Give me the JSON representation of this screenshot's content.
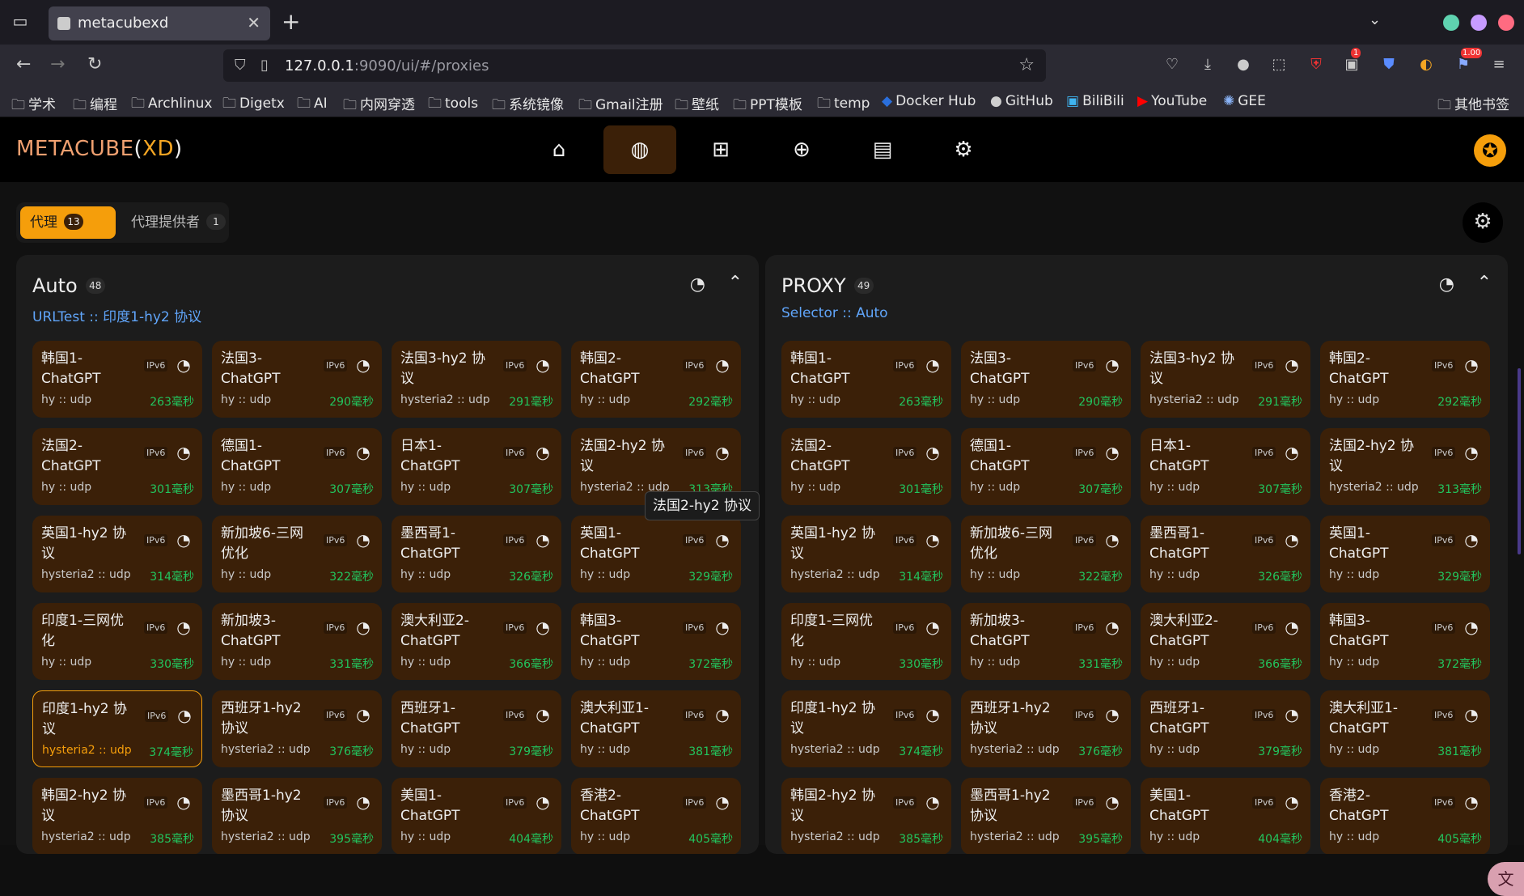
{
  "browser": {
    "tab_title": "metacubexd",
    "url_host": "127.0.0.1",
    "url_rest": ":9090/ui/#/proxies",
    "bookmarks": [
      "学术",
      "编程",
      "Archlinux",
      "Digetx",
      "AI",
      "内网穿透",
      "tools",
      "系统镜像",
      "Gmail注册",
      "壁纸",
      "PPT模板",
      "temp",
      "Docker Hub",
      "GitHub",
      "BiliBili",
      "YouTube",
      "GEE"
    ],
    "other_bookmarks": "其他书签",
    "ext_badges": {
      "ublock": "1",
      "rss": "1.00"
    }
  },
  "app": {
    "logo_main": "METACUBE",
    "logo_open": "(",
    "logo_xd": "XD",
    "logo_close": ")",
    "accent": "#f59e0b",
    "card_bg": "#3b2008",
    "latency_color": "#22c55e"
  },
  "tabs": {
    "proxies_label": "代理",
    "proxies_count": "13",
    "providers_label": "代理提供者",
    "providers_count": "1"
  },
  "tooltip": "法国2-hy2 协议",
  "groups": [
    {
      "name": "Auto",
      "count": "48",
      "subtitle": "URLTest :: 印度1-hy2 协议",
      "proxies": [
        {
          "name": "韩国1-ChatGPT",
          "type": "hy :: udp",
          "ipv6": "IPv6",
          "latency": "263毫秒"
        },
        {
          "name": "法国3-ChatGPT",
          "type": "hy :: udp",
          "ipv6": "IPv6",
          "latency": "290毫秒"
        },
        {
          "name": "法国3-hy2 协议",
          "type": "hysteria2 :: udp",
          "ipv6": "IPv6",
          "latency": "291毫秒"
        },
        {
          "name": "韩国2-ChatGPT",
          "type": "hy :: udp",
          "ipv6": "IPv6",
          "latency": "292毫秒"
        },
        {
          "name": "法国2-ChatGPT",
          "type": "hy :: udp",
          "ipv6": "IPv6",
          "latency": "301毫秒"
        },
        {
          "name": "德国1-ChatGPT",
          "type": "hy :: udp",
          "ipv6": "IPv6",
          "latency": "307毫秒"
        },
        {
          "name": "日本1-ChatGPT",
          "type": "hy :: udp",
          "ipv6": "IPv6",
          "latency": "307毫秒"
        },
        {
          "name": "法国2-hy2 协议",
          "type": "hysteria2 :: udp",
          "ipv6": "IPv6",
          "latency": "313毫秒"
        },
        {
          "name": "英国1-hy2 协议",
          "type": "hysteria2 :: udp",
          "ipv6": "IPv6",
          "latency": "314毫秒"
        },
        {
          "name": "新加坡6-三网优化",
          "type": "hy :: udp",
          "ipv6": "IPv6",
          "latency": "322毫秒"
        },
        {
          "name": "墨西哥1-ChatGPT",
          "type": "hy :: udp",
          "ipv6": "IPv6",
          "latency": "326毫秒"
        },
        {
          "name": "英国1-ChatGPT",
          "type": "hy :: udp",
          "ipv6": "IPv6",
          "latency": "329毫秒"
        },
        {
          "name": "印度1-三网优化",
          "type": "hy :: udp",
          "ipv6": "IPv6",
          "latency": "330毫秒"
        },
        {
          "name": "新加坡3-ChatGPT",
          "type": "hy :: udp",
          "ipv6": "IPv6",
          "latency": "331毫秒"
        },
        {
          "name": "澳大利亚2-ChatGPT",
          "type": "hy :: udp",
          "ipv6": "IPv6",
          "latency": "366毫秒"
        },
        {
          "name": "韩国3-ChatGPT",
          "type": "hy :: udp",
          "ipv6": "IPv6",
          "latency": "372毫秒"
        },
        {
          "name": "印度1-hy2 协议",
          "type": "hysteria2 :: udp",
          "ipv6": "IPv6",
          "latency": "374毫秒",
          "selected": true
        },
        {
          "name": "西班牙1-hy2 协议",
          "type": "hysteria2 :: udp",
          "ipv6": "IPv6",
          "latency": "376毫秒"
        },
        {
          "name": "西班牙1-ChatGPT",
          "type": "hy :: udp",
          "ipv6": "IPv6",
          "latency": "379毫秒"
        },
        {
          "name": "澳大利亚1-ChatGPT",
          "type": "hy :: udp",
          "ipv6": "IPv6",
          "latency": "381毫秒"
        },
        {
          "name": "韩国2-hy2 协议",
          "type": "hysteria2 :: udp",
          "ipv6": "IPv6",
          "latency": "385毫秒"
        },
        {
          "name": "墨西哥1-hy2 协议",
          "type": "hysteria2 :: udp",
          "ipv6": "IPv6",
          "latency": "395毫秒"
        },
        {
          "name": "美国1-ChatGPT",
          "type": "hy :: udp",
          "ipv6": "IPv6",
          "latency": "404毫秒"
        },
        {
          "name": "香港2-ChatGPT",
          "type": "hy :: udp",
          "ipv6": "IPv6",
          "latency": "405毫秒"
        }
      ]
    },
    {
      "name": "PROXY",
      "count": "49",
      "subtitle": "Selector :: Auto",
      "proxies": [
        {
          "name": "韩国1-ChatGPT",
          "type": "hy :: udp",
          "ipv6": "IPv6",
          "latency": "263毫秒"
        },
        {
          "name": "法国3-ChatGPT",
          "type": "hy :: udp",
          "ipv6": "IPv6",
          "latency": "290毫秒"
        },
        {
          "name": "法国3-hy2 协议",
          "type": "hysteria2 :: udp",
          "ipv6": "IPv6",
          "latency": "291毫秒"
        },
        {
          "name": "韩国2-ChatGPT",
          "type": "hy :: udp",
          "ipv6": "IPv6",
          "latency": "292毫秒"
        },
        {
          "name": "法国2-ChatGPT",
          "type": "hy :: udp",
          "ipv6": "IPv6",
          "latency": "301毫秒"
        },
        {
          "name": "德国1-ChatGPT",
          "type": "hy :: udp",
          "ipv6": "IPv6",
          "latency": "307毫秒"
        },
        {
          "name": "日本1-ChatGPT",
          "type": "hy :: udp",
          "ipv6": "IPv6",
          "latency": "307毫秒"
        },
        {
          "name": "法国2-hy2 协议",
          "type": "hysteria2 :: udp",
          "ipv6": "IPv6",
          "latency": "313毫秒"
        },
        {
          "name": "英国1-hy2 协议",
          "type": "hysteria2 :: udp",
          "ipv6": "IPv6",
          "latency": "314毫秒"
        },
        {
          "name": "新加坡6-三网优化",
          "type": "hy :: udp",
          "ipv6": "IPv6",
          "latency": "322毫秒"
        },
        {
          "name": "墨西哥1-ChatGPT",
          "type": "hy :: udp",
          "ipv6": "IPv6",
          "latency": "326毫秒"
        },
        {
          "name": "英国1-ChatGPT",
          "type": "hy :: udp",
          "ipv6": "IPv6",
          "latency": "329毫秒"
        },
        {
          "name": "印度1-三网优化",
          "type": "hy :: udp",
          "ipv6": "IPv6",
          "latency": "330毫秒"
        },
        {
          "name": "新加坡3-ChatGPT",
          "type": "hy :: udp",
          "ipv6": "IPv6",
          "latency": "331毫秒"
        },
        {
          "name": "澳大利亚2-ChatGPT",
          "type": "hy :: udp",
          "ipv6": "IPv6",
          "latency": "366毫秒"
        },
        {
          "name": "韩国3-ChatGPT",
          "type": "hy :: udp",
          "ipv6": "IPv6",
          "latency": "372毫秒"
        },
        {
          "name": "印度1-hy2 协议",
          "type": "hysteria2 :: udp",
          "ipv6": "IPv6",
          "latency": "374毫秒"
        },
        {
          "name": "西班牙1-hy2 协议",
          "type": "hysteria2 :: udp",
          "ipv6": "IPv6",
          "latency": "376毫秒"
        },
        {
          "name": "西班牙1-ChatGPT",
          "type": "hy :: udp",
          "ipv6": "IPv6",
          "latency": "379毫秒"
        },
        {
          "name": "澳大利亚1-ChatGPT",
          "type": "hy :: udp",
          "ipv6": "IPv6",
          "latency": "381毫秒"
        },
        {
          "name": "韩国2-hy2 协议",
          "type": "hysteria2 :: udp",
          "ipv6": "IPv6",
          "latency": "385毫秒"
        },
        {
          "name": "墨西哥1-hy2 协议",
          "type": "hysteria2 :: udp",
          "ipv6": "IPv6",
          "latency": "395毫秒"
        },
        {
          "name": "美国1-ChatGPT",
          "type": "hy :: udp",
          "ipv6": "IPv6",
          "latency": "404毫秒"
        },
        {
          "name": "香港2-ChatGPT",
          "type": "hy :: udp",
          "ipv6": "IPv6",
          "latency": "405毫秒"
        }
      ]
    }
  ]
}
